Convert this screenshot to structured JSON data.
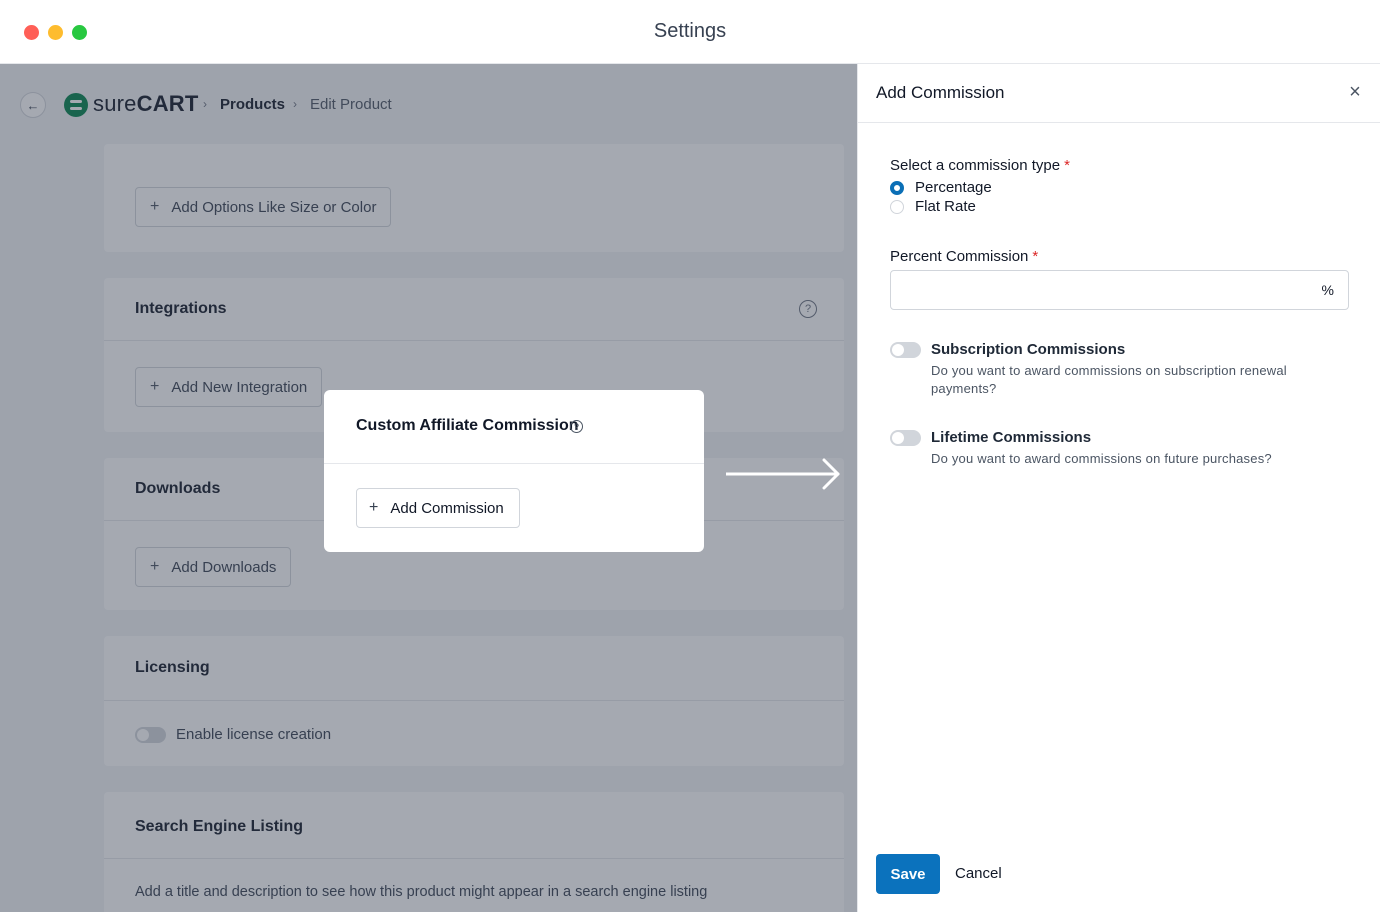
{
  "window": {
    "title": "Settings"
  },
  "header": {
    "back_icon": "arrow-left-icon",
    "logo": {
      "part1": "sure",
      "part2": "CART"
    },
    "breadcrumb": [
      "Products",
      "Edit Product"
    ]
  },
  "cards": {
    "options": {
      "button_label": "Add Options Like Size or Color"
    },
    "integrations": {
      "title": "Integrations",
      "button_label": "Add New Integration"
    },
    "downloads": {
      "title": "Downloads",
      "button_label": "Add Downloads"
    },
    "licensing": {
      "title": "Licensing",
      "toggle_label": "Enable license creation"
    },
    "seo": {
      "title": "Search Engine Listing",
      "description": "Add a title and description to see how this product might appear in a search engine listing"
    }
  },
  "popup": {
    "title": "Custom Affiliate Commission",
    "button_label": "Add Commission"
  },
  "drawer": {
    "title": "Add Commission",
    "commission_type": {
      "label": "Select a commission type",
      "options": [
        {
          "label": "Percentage",
          "selected": true
        },
        {
          "label": "Flat Rate",
          "selected": false
        }
      ]
    },
    "percent": {
      "label": "Percent Commission",
      "value": "",
      "suffix": "%"
    },
    "subscription": {
      "title": "Subscription Commissions",
      "description": "Do you want to award commissions on subscription renewal payments?",
      "enabled": false
    },
    "lifetime": {
      "title": "Lifetime Commissions",
      "description": "Do you want to award commissions on future purchases?",
      "enabled": false
    },
    "save_label": "Save",
    "cancel_label": "Cancel"
  },
  "colors": {
    "primary": "#0b72bd",
    "required": "#dc2626",
    "brand": "#01824c"
  }
}
